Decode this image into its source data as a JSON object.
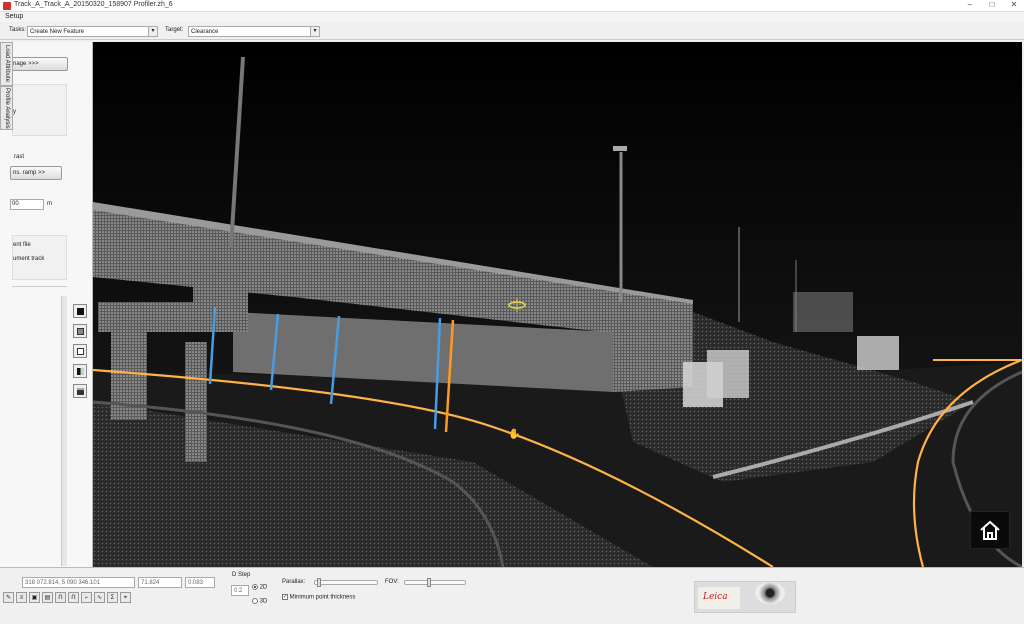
{
  "window": {
    "title": "Track_A_Track_A_20150320_158907 Profiler.zh_6",
    "min": "–",
    "max": "□",
    "close": "✕"
  },
  "menu": {
    "setup": "Setup"
  },
  "toolbar": {
    "tasks_label": "Tasks:",
    "tasks_value": "Create New Feature",
    "target_label": "Target:",
    "target_value": "Clearance"
  },
  "side_tabs": [
    "Load Attribute",
    "Profile Analysis"
  ],
  "side_panel": {
    "image_btn": "nage >>>",
    "y_hint": "y",
    "contrast_label": "rast",
    "ramp_btn": "ns. ramp >>",
    "distance_value": "00",
    "distance_unit": "m",
    "alignment_file": "ent file",
    "alignment_track": "ument track"
  },
  "status": {
    "coord_xy": "318 072.814, 5 090 346.101",
    "coord_z": "71.824",
    "coord_d": "0.083",
    "dstep_label": "D Step",
    "dstep_value": "0.2",
    "mode_2d": "2D",
    "mode_3d": "3D",
    "parallax_label": "Parallax:",
    "fov_label": "FOV:",
    "min_point_label": "Minimum point thickness"
  },
  "leica": {
    "brand": "Leica"
  },
  "colors": {
    "alignment": "#ffb347",
    "clearance_blue": "#4a9ce0",
    "clearance_orange": "#ff9a20"
  }
}
